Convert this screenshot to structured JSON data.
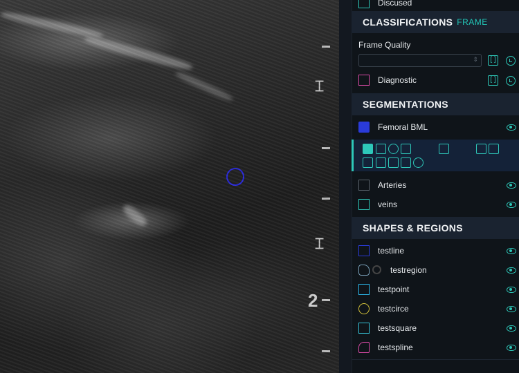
{
  "panel": {
    "top_partial_item": {
      "label": "Discused"
    },
    "classifications": {
      "title": "CLASSIFICATIONS",
      "subtitle": "FRAME",
      "frame_quality_label": "Frame Quality",
      "frame_quality_value": "",
      "diagnostic_label": "Diagnostic",
      "bracket_label": "[ ]"
    },
    "segmentations": {
      "title": "SEGMENTATIONS",
      "items": [
        {
          "label": "Femoral BML",
          "color": "#2a3bd9"
        },
        {
          "label": "Arteries",
          "color": "#59626b"
        },
        {
          "label": "veins",
          "color": "#2ec8b9"
        }
      ]
    },
    "shapes": {
      "title": "SHAPES & REGIONS",
      "items": [
        {
          "label": "testline",
          "icon": "line-icon",
          "color": "#2a3bd9"
        },
        {
          "label": "testregion",
          "icon": "region-icon",
          "color": "#7aa0b8"
        },
        {
          "label": "testpoint",
          "icon": "point-icon",
          "color": "#2bb6e8"
        },
        {
          "label": "testcirce",
          "icon": "circle-icon",
          "color": "#d4c23a"
        },
        {
          "label": "testsquare",
          "icon": "square-icon",
          "color": "#36c2d6"
        },
        {
          "label": "testspline",
          "icon": "spline-icon",
          "color": "#d94aa6"
        }
      ]
    }
  },
  "viewer": {
    "scale_number": "2"
  }
}
